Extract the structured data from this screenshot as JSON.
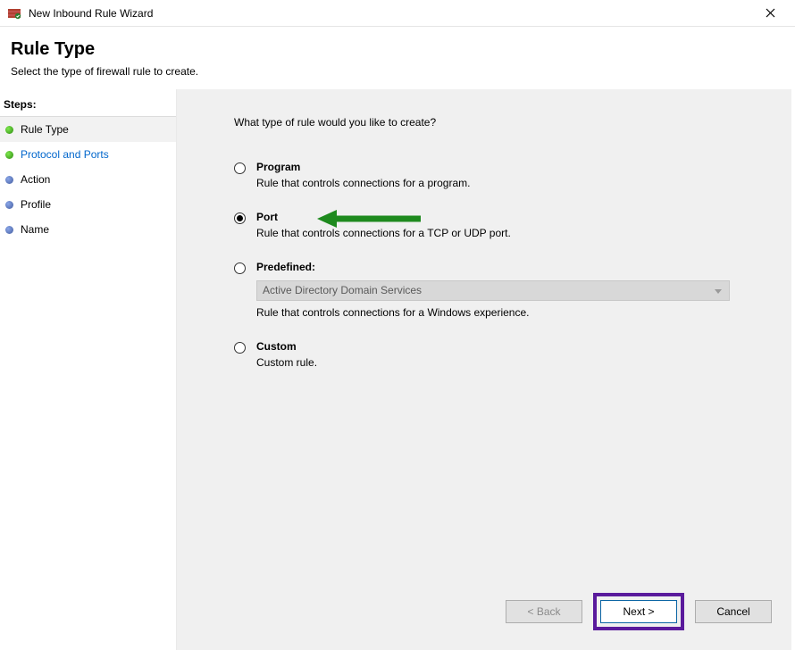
{
  "window": {
    "title": "New Inbound Rule Wizard"
  },
  "header": {
    "title": "Rule Type",
    "subtitle": "Select the type of firewall rule to create."
  },
  "sidebar": {
    "label": "Steps:",
    "items": [
      {
        "label": "Rule Type",
        "state": "current"
      },
      {
        "label": "Protocol and Ports",
        "state": "next"
      },
      {
        "label": "Action",
        "state": "pending"
      },
      {
        "label": "Profile",
        "state": "pending"
      },
      {
        "label": "Name",
        "state": "pending"
      }
    ]
  },
  "main": {
    "question": "What type of rule would you like to create?",
    "options": {
      "program": {
        "title": "Program",
        "desc": "Rule that controls connections for a program."
      },
      "port": {
        "title": "Port",
        "desc": "Rule that controls connections for a TCP or UDP port."
      },
      "predefined": {
        "title": "Predefined:",
        "select_value": "Active Directory Domain Services",
        "desc": "Rule that controls connections for a Windows experience."
      },
      "custom": {
        "title": "Custom",
        "desc": "Custom rule."
      }
    },
    "selected": "port"
  },
  "footer": {
    "back": "< Back",
    "next": "Next >",
    "cancel": "Cancel"
  }
}
